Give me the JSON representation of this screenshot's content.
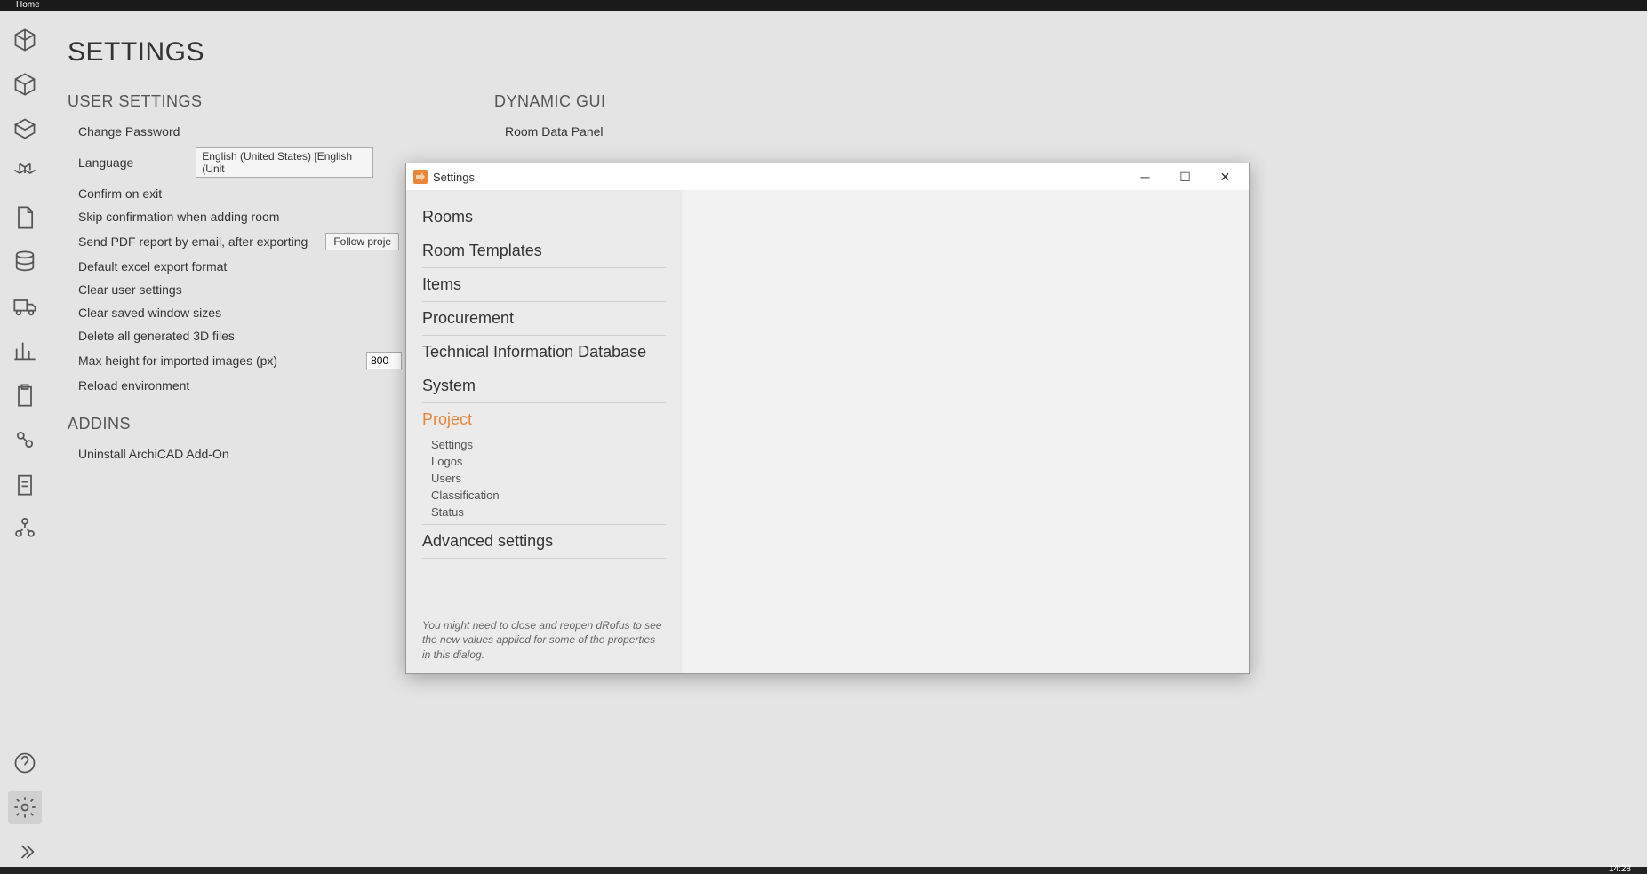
{
  "topbar": {
    "home": "Home"
  },
  "page": {
    "title": "SETTINGS"
  },
  "user_settings": {
    "title": "USER SETTINGS",
    "change_password": "Change Password",
    "language": "Language",
    "language_value": "English (United States) [English (Unit",
    "confirm_exit": "Confirm on exit",
    "skip_confirm": "Skip confirmation when adding room",
    "send_pdf": "Send PDF report by email, after exporting",
    "follow_proj": "Follow proje",
    "default_excel": "Default excel export format",
    "clear_user": "Clear user settings",
    "clear_window": "Clear saved window sizes",
    "delete_3d": "Delete all generated 3D files",
    "max_height": "Max height for imported images (px)",
    "max_height_val": "800",
    "reload_env": "Reload environment"
  },
  "addins": {
    "title": "ADDINS",
    "uninstall": "Uninstall ArchiCAD Add-On"
  },
  "dynamic_gui": {
    "title": "DYNAMIC GUI",
    "room_data": "Room Data Panel"
  },
  "dialog": {
    "title": "Settings",
    "nav": {
      "rooms": "Rooms",
      "room_templates": "Room Templates",
      "items": "Items",
      "procurement": "Procurement",
      "tid": "Technical Information Database",
      "system": "System",
      "project": "Project",
      "project_subs": {
        "settings": "Settings",
        "logos": "Logos",
        "users": "Users",
        "classification": "Classification",
        "status": "Status"
      },
      "advanced": "Advanced settings"
    },
    "hint": "You might need to close and reopen dRofus to see the new values applied for some of the properties in this dialog."
  },
  "clock": "14:28"
}
